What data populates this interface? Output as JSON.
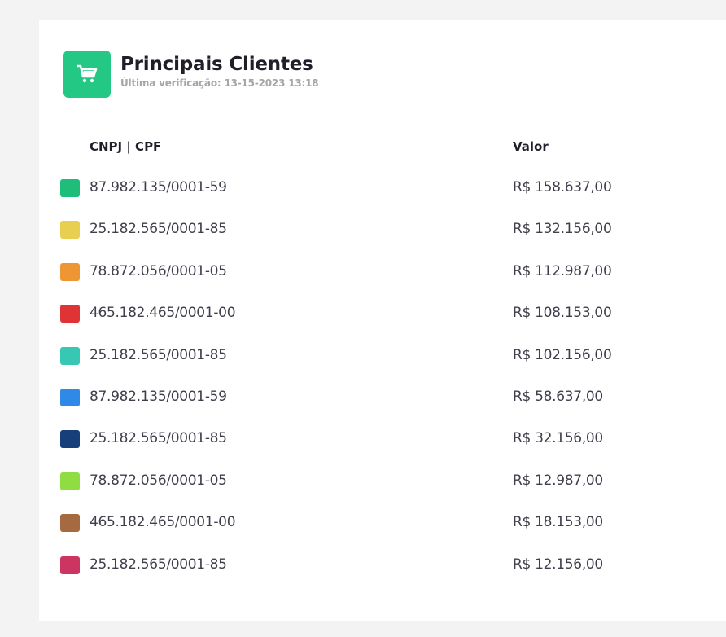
{
  "header": {
    "icon": "shopping-cart-icon",
    "title": "Principais Clientes",
    "subtitle": "Última verificação: 13-15-2023 13:18",
    "icon_bg_color": "#22c883"
  },
  "table": {
    "columns": [
      "CNPJ | CPF",
      "Valor"
    ],
    "rows": [
      {
        "doc": "87.982.135/0001-59",
        "valor": "R$ 158.637,00",
        "color": "#1fbd7a"
      },
      {
        "doc": "25.182.565/0001-85",
        "valor": "R$ 132.156,00",
        "color": "#e8cf4f"
      },
      {
        "doc": "78.872.056/0001-05",
        "valor": "R$ 112.987,00",
        "color": "#ee9634"
      },
      {
        "doc": "465.182.465/0001-00",
        "valor": "R$ 108.153,00",
        "color": "#df3336"
      },
      {
        "doc": "25.182.565/0001-85",
        "valor": "R$ 102.156,00",
        "color": "#36c8b3"
      },
      {
        "doc": "87.982.135/0001-59",
        "valor": "R$ 58.637,00",
        "color": "#2e8ae6"
      },
      {
        "doc": "25.182.565/0001-85",
        "valor": "R$ 32.156,00",
        "color": "#173f7a"
      },
      {
        "doc": "78.872.056/0001-05",
        "valor": "R$ 12.987,00",
        "color": "#8fdc43"
      },
      {
        "doc": "465.182.465/0001-00",
        "valor": "R$ 18.153,00",
        "color": "#a56a40"
      },
      {
        "doc": "25.182.565/0001-85",
        "valor": "R$ 12.156,00",
        "color": "#cc3562"
      }
    ]
  }
}
